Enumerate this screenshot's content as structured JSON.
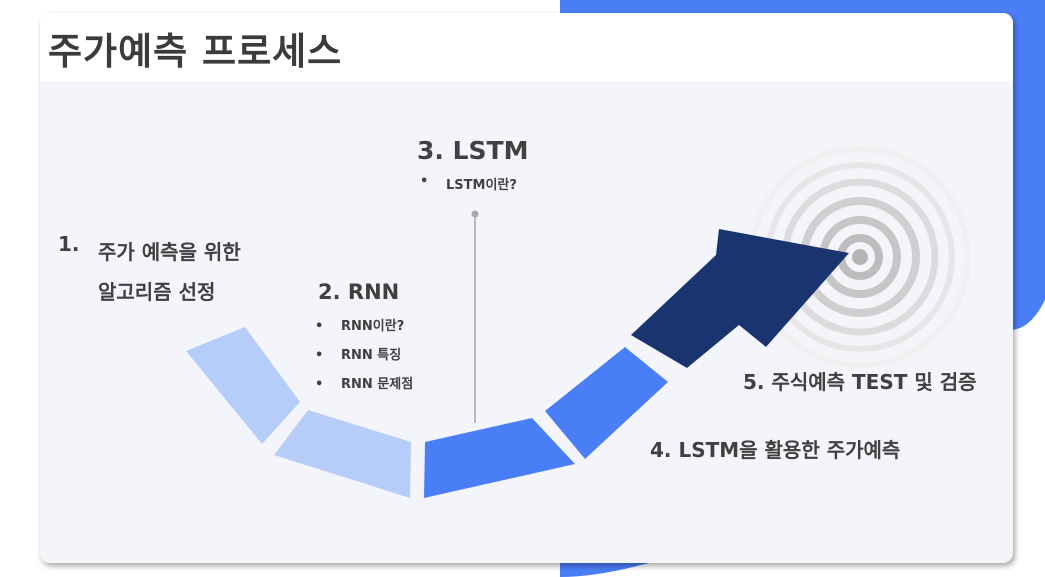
{
  "slide": {
    "title": "주가예측 프로세스"
  },
  "steps": {
    "step1": {
      "number": "1.",
      "line1": "주가 예측을 위한",
      "line2": "알고리즘 선정"
    },
    "step2": {
      "title": "2. RNN",
      "bullets": [
        "RNN이란?",
        "RNN 특징",
        "RNN 문제점"
      ]
    },
    "step3": {
      "title": "3. LSTM",
      "bullets": [
        "LSTM이란?"
      ]
    },
    "step4": {
      "title": "4. LSTM을 활용한 주가예측"
    },
    "step5": {
      "title": "5. 주식예측 TEST 및 검증"
    }
  },
  "colors": {
    "accent_blue": "#4a7ef7",
    "light_blue": "#b7cdf9",
    "dark_navy": "#1a3470",
    "card_bg": "#f3f5fa",
    "target_gray": "#bbbbbb"
  },
  "icons": {
    "arrow": "curved-arrow-icon",
    "target": "target-icon"
  }
}
